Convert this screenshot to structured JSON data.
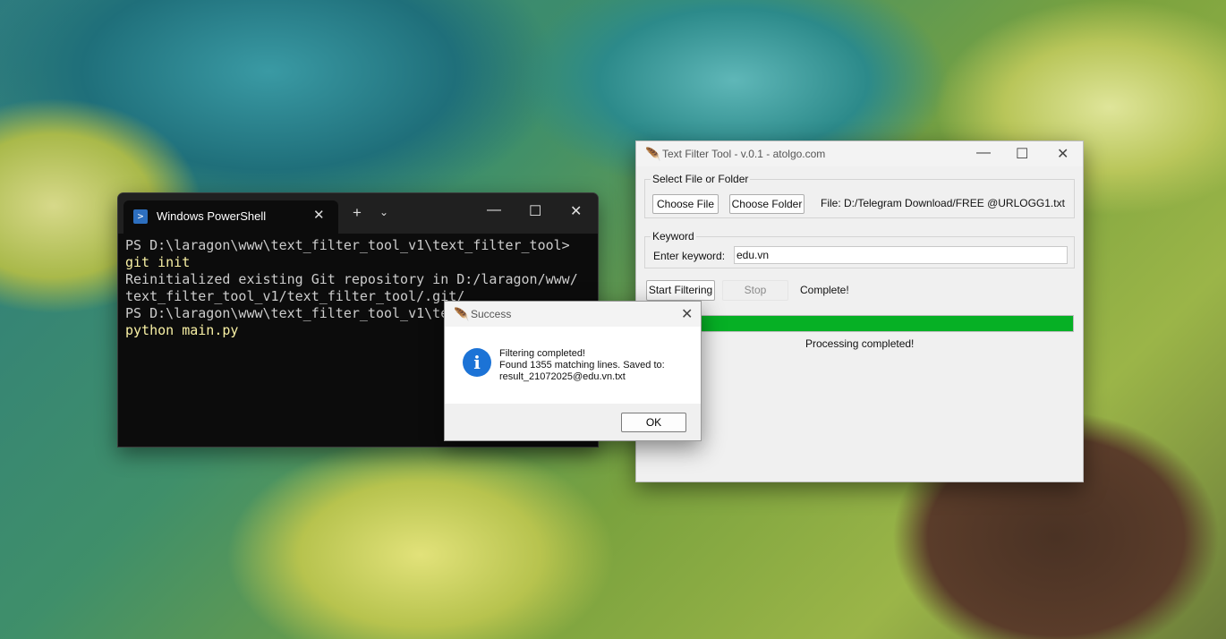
{
  "powershell": {
    "tab_title": "Windows PowerShell",
    "tab_close": "✕",
    "new_tab": "+",
    "dropdown": "⌄",
    "minimize": "—",
    "maximize": "☐",
    "close": "✕",
    "lines": [
      {
        "text": "PS D:\\laragon\\www\\text_filter_tool_v1\\text_filter_tool>",
        "kind": "out"
      },
      {
        "text": "git init",
        "kind": "cmd"
      },
      {
        "text": "Reinitialized existing Git repository in D:/laragon/www/",
        "kind": "out"
      },
      {
        "text": "text_filter_tool_v1/text_filter_tool/.git/",
        "kind": "out"
      },
      {
        "text": "PS D:\\laragon\\www\\text_filter_tool_v1\\te",
        "kind": "out"
      },
      {
        "text": "python main.py",
        "kind": "cmd"
      }
    ]
  },
  "tool": {
    "title": "Text Filter Tool - v.0.1 - atolgo.com",
    "minimize": "—",
    "maximize": "☐",
    "close": "✕",
    "select_group": "Select File or Folder",
    "choose_file": "Choose File",
    "choose_folder": "Choose Folder",
    "file_path": "File: D:/Telegram Download/FREE @URLOGG1.txt",
    "keyword_group": "Keyword",
    "enter_keyword_label": "Enter keyword:",
    "keyword_value": "edu.vn",
    "start_button": "Start Filtering",
    "stop_button": "Stop",
    "status": "Complete!",
    "progress": 1.0,
    "progress_text": "Processing completed!"
  },
  "dialog": {
    "title": "Success",
    "close": "✕",
    "message": "Filtering completed!\nFound 1355 matching lines. Saved to:\nresult_21072025@edu.vn.txt",
    "ok": "OK"
  },
  "colors": {
    "progress": "#06b025",
    "info_icon": "#1c73d6",
    "console_bg": "#0c0c0c",
    "console_cmd": "#f9f1a5"
  },
  "icons": {
    "app": "feather-icon",
    "powershell": "powershell-icon",
    "info": "info-icon"
  }
}
